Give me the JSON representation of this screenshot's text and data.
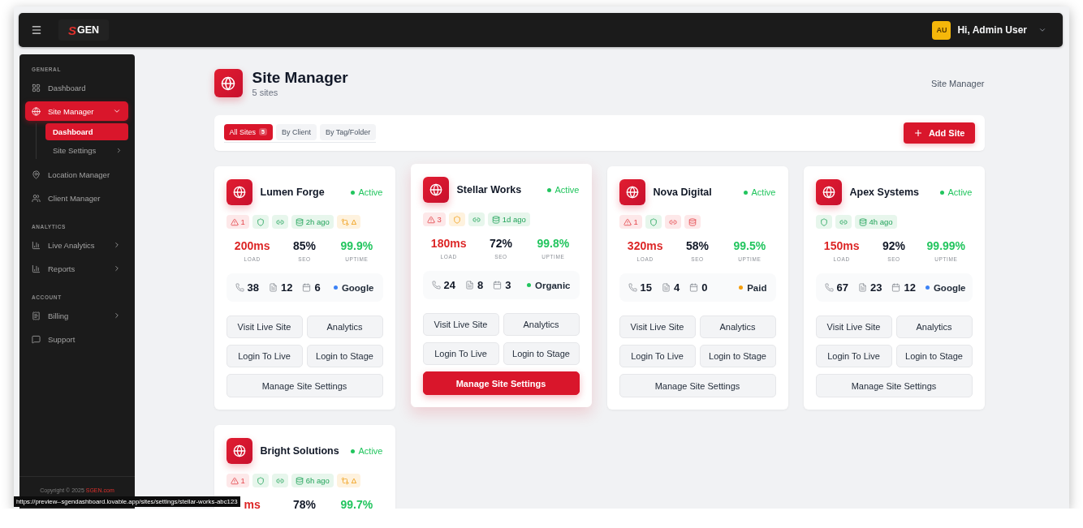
{
  "topbar": {
    "logo": {
      "mark": "S",
      "text": "GEN"
    },
    "user": {
      "initials": "AU",
      "greeting": "Hi, Admin User"
    }
  },
  "sidebar": {
    "sections": [
      {
        "title": "GENERAL",
        "items": [
          {
            "label": "Dashboard",
            "kind": "link",
            "selected": false
          },
          {
            "label": "Site Manager",
            "kind": "group",
            "selected": true,
            "expanded": true,
            "children": [
              {
                "label": "Dashboard",
                "kind": "link",
                "selected": true
              },
              {
                "label": "Site Settings",
                "kind": "group",
                "selected": false,
                "expanded": false
              }
            ]
          },
          {
            "label": "Location Manager",
            "kind": "link",
            "selected": false
          },
          {
            "label": "Client Manager",
            "kind": "link",
            "selected": false
          }
        ]
      },
      {
        "title": "ANALYTICS",
        "items": [
          {
            "label": "Live Analytics",
            "kind": "group",
            "selected": false,
            "expanded": false
          },
          {
            "label": "Reports",
            "kind": "group",
            "selected": false,
            "expanded": false
          }
        ]
      },
      {
        "title": "ACCOUNT",
        "items": [
          {
            "label": "Billing",
            "kind": "group",
            "selected": false,
            "expanded": false
          },
          {
            "label": "Support",
            "kind": "link",
            "selected": false
          }
        ]
      }
    ],
    "footer": {
      "text": "Copyright © 2025",
      "link": "SGEN.com"
    }
  },
  "page": {
    "title": "Site Manager",
    "subtitle": "5 sites",
    "breadcrumb": "Site Manager"
  },
  "filters": {
    "tabs": [
      {
        "label": "All Sites",
        "count": "5",
        "selected": true
      },
      {
        "label": "By Client",
        "selected": false
      },
      {
        "label": "By Tag/Folder",
        "selected": false
      }
    ],
    "add_button": "Add Site"
  },
  "sites": [
    {
      "name": "Lumen Forge",
      "status": "Active",
      "active": true,
      "hovered": false,
      "badges": [
        {
          "kind": "alert",
          "error": true,
          "warning": false,
          "text": "1"
        },
        {
          "kind": "ssl",
          "error": false,
          "warning": false
        },
        {
          "kind": "link",
          "error": false,
          "warning": false
        },
        {
          "kind": "backup",
          "error": false,
          "warning": false,
          "text": "2h ago"
        },
        {
          "kind": "change",
          "error": false,
          "warning": true,
          "text": "Δ"
        }
      ],
      "metrics": [
        {
          "kind": "load",
          "value": "200ms",
          "label": "LOAD"
        },
        {
          "kind": "seo",
          "value": "85%",
          "label": "SEO"
        },
        {
          "kind": "uptime",
          "value": "99.9%",
          "label": "UPTIME"
        }
      ],
      "stats": [
        "38",
        "12",
        "6"
      ],
      "source": {
        "label": "Google",
        "color": "#3b82f6"
      },
      "actions": [
        "Visit Live Site",
        "Analytics",
        "Login To Live",
        "Login to Stage"
      ],
      "settings_button": "Manage Site Settings"
    },
    {
      "name": "Stellar Works",
      "status": "Active",
      "active": true,
      "hovered": true,
      "badges": [
        {
          "kind": "alert",
          "error": true,
          "warning": false,
          "text": "3"
        },
        {
          "kind": "ssl",
          "error": false,
          "warning": true
        },
        {
          "kind": "link",
          "error": false,
          "warning": false
        },
        {
          "kind": "backup",
          "error": false,
          "warning": false,
          "text": "1d ago"
        }
      ],
      "metrics": [
        {
          "kind": "load",
          "value": "180ms",
          "label": "LOAD"
        },
        {
          "kind": "seo",
          "value": "72%",
          "label": "SEO"
        },
        {
          "kind": "uptime",
          "value": "99.8%",
          "label": "UPTIME"
        }
      ],
      "stats": [
        "24",
        "8",
        "3"
      ],
      "source": {
        "label": "Organic",
        "color": "#22c55e"
      },
      "actions": [
        "Visit Live Site",
        "Analytics",
        "Login To Live",
        "Login to Stage"
      ],
      "settings_button": "Manage Site Settings"
    },
    {
      "name": "Nova Digital",
      "status": "Active",
      "active": true,
      "hovered": false,
      "badges": [
        {
          "kind": "alert",
          "error": true,
          "warning": false,
          "text": "1"
        },
        {
          "kind": "ssl",
          "error": false,
          "warning": false
        },
        {
          "kind": "link",
          "error": true,
          "warning": false
        },
        {
          "kind": "backup",
          "error": true,
          "warning": false
        }
      ],
      "metrics": [
        {
          "kind": "load",
          "value": "320ms",
          "label": "LOAD"
        },
        {
          "kind": "seo",
          "value": "58%",
          "label": "SEO"
        },
        {
          "kind": "uptime",
          "value": "99.5%",
          "label": "UPTIME"
        }
      ],
      "stats": [
        "15",
        "4",
        "0"
      ],
      "source": {
        "label": "Paid",
        "color": "#f59e0b"
      },
      "actions": [
        "Visit Live Site",
        "Analytics",
        "Login To Live",
        "Login to Stage"
      ],
      "settings_button": "Manage Site Settings"
    },
    {
      "name": "Apex Systems",
      "status": "Active",
      "active": true,
      "hovered": false,
      "badges": [
        {
          "kind": "ssl",
          "error": false,
          "warning": false
        },
        {
          "kind": "link",
          "error": false,
          "warning": false
        },
        {
          "kind": "backup",
          "error": false,
          "warning": false,
          "text": "4h ago"
        }
      ],
      "metrics": [
        {
          "kind": "load",
          "value": "150ms",
          "label": "LOAD"
        },
        {
          "kind": "seo",
          "value": "92%",
          "label": "SEO"
        },
        {
          "kind": "uptime",
          "value": "99.99%",
          "label": "UPTIME"
        }
      ],
      "stats": [
        "67",
        "23",
        "12"
      ],
      "source": {
        "label": "Google",
        "color": "#3b82f6"
      },
      "actions": [
        "Visit Live Site",
        "Analytics",
        "Login To Live",
        "Login to Stage"
      ],
      "settings_button": "Manage Site Settings"
    },
    {
      "name": "Bright Solutions",
      "status": "Active",
      "active": true,
      "hovered": false,
      "badges": [
        {
          "kind": "alert",
          "error": true,
          "warning": false,
          "text": "1"
        },
        {
          "kind": "ssl",
          "error": false,
          "warning": false
        },
        {
          "kind": "link",
          "error": false,
          "warning": false
        },
        {
          "kind": "backup",
          "error": false,
          "warning": false,
          "text": "6h ago"
        },
        {
          "kind": "change",
          "error": false,
          "warning": true,
          "text": "Δ"
        }
      ],
      "metrics": [
        {
          "kind": "load",
          "value": "ms"
        },
        {
          "kind": "seo",
          "value": "78%"
        },
        {
          "kind": "uptime",
          "value": "99.7%"
        }
      ]
    }
  ],
  "link_preview": "https://preview--sgendashboard.lovable.app/sites/settings/stellar-works-abc123"
}
